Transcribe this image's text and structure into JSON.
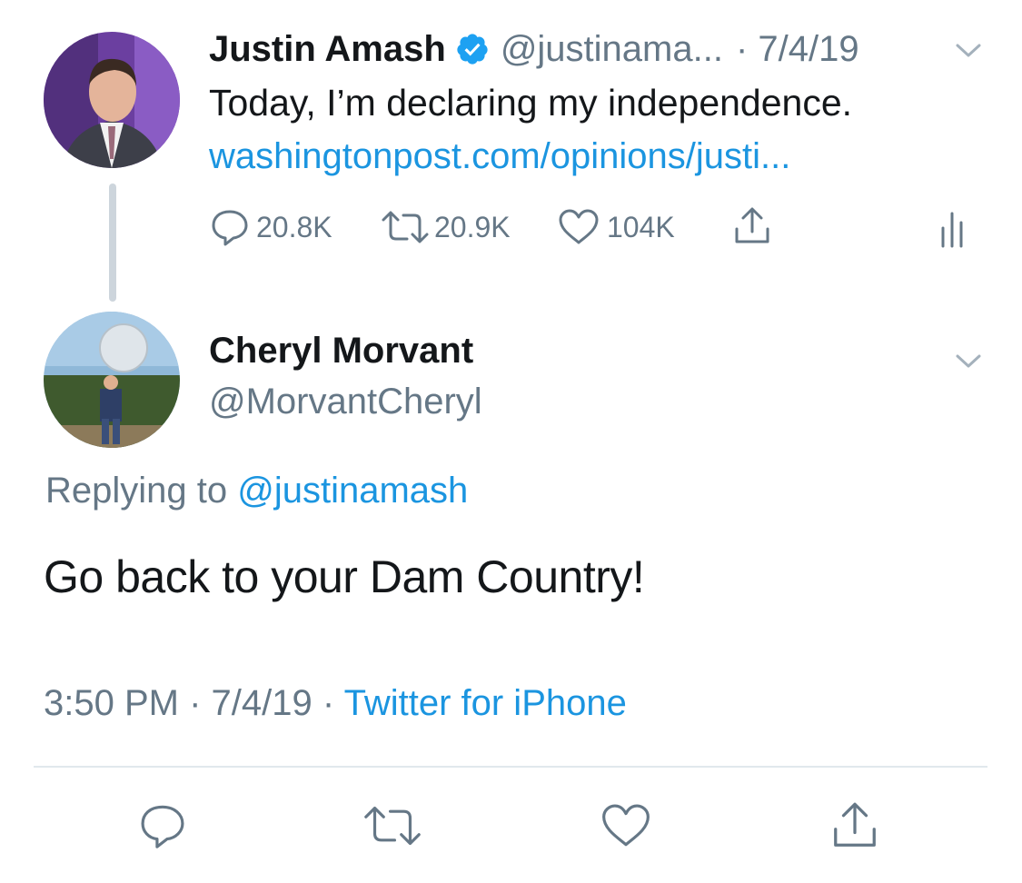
{
  "parent_tweet": {
    "author_name": "Justin Amash",
    "handle": "@justinama...",
    "date": "· 7/4/19",
    "text": "Today, I’m declaring my independence.",
    "link": "washingtonpost.com/opinions/justi...",
    "stats": {
      "replies": "20.8K",
      "retweets": "20.9K",
      "likes": "104K"
    },
    "verified": true
  },
  "reply_tweet": {
    "author_name": "Cheryl Morvant",
    "handle": "@MorvantCheryl",
    "replying_prefix": "Replying to",
    "replying_handle": "@justinamash",
    "text": "Go back to your Dam Country!",
    "time": "3:50 PM",
    "separator": "·",
    "date": "7/4/19",
    "source": "Twitter for iPhone"
  },
  "colors": {
    "link_blue": "#1b95e0",
    "secondary_gray": "#657786",
    "icon_gray": "#657786",
    "divider": "#e1e8ed"
  },
  "icons": [
    "reply-icon",
    "retweet-icon",
    "like-icon",
    "share-icon",
    "analytics-icon",
    "chevron-down-icon",
    "verified-badge-icon"
  ]
}
